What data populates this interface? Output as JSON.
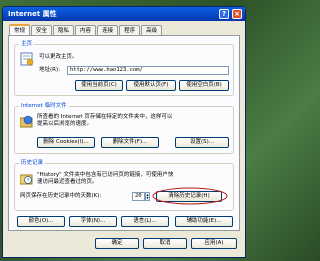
{
  "window": {
    "title": "Internet 属性",
    "help": "?",
    "close": "×"
  },
  "tabs": [
    "常规",
    "安全",
    "隐私",
    "内容",
    "连接",
    "程序",
    "高级"
  ],
  "homepage": {
    "legend": "主页",
    "desc": "可以更改主页。",
    "address_label": "地址(R):",
    "address_value": "http://www.hao123.com/",
    "btn_current": "使用当前页(C)",
    "btn_default": "使用默认页(F)",
    "btn_blank": "使用空白页(B)"
  },
  "temp_files": {
    "legend": "Internet 临时文件",
    "desc1": "所查看的 Internet 页存储在特定的文件夹中，这样可以",
    "desc2": "提高以后浏览的速度。",
    "btn_cookies": "删除 Cookies(I)...",
    "btn_delete_files": "删除文件(F)...",
    "btn_settings": "设置(S)..."
  },
  "history": {
    "legend": "历史记录",
    "desc1": "\"History\" 文件夹中包含有已访问页的链接，可使用户快",
    "desc2": "速访问最近查看过的页。",
    "days_label": "网页保存在历史记录中的天数(K):",
    "days_value": "20",
    "btn_clear": "清除历史记录(H)"
  },
  "buttons_row": [
    "颜色(O)...",
    "字体(N)...",
    "语言(L)...",
    "辅助功能(E)..."
  ],
  "footer": {
    "ok": "确定",
    "cancel": "取消",
    "apply": "应用(A)"
  },
  "colors": {
    "titlebar": "#0a5fe0",
    "highlight_circle": "#c01818"
  }
}
